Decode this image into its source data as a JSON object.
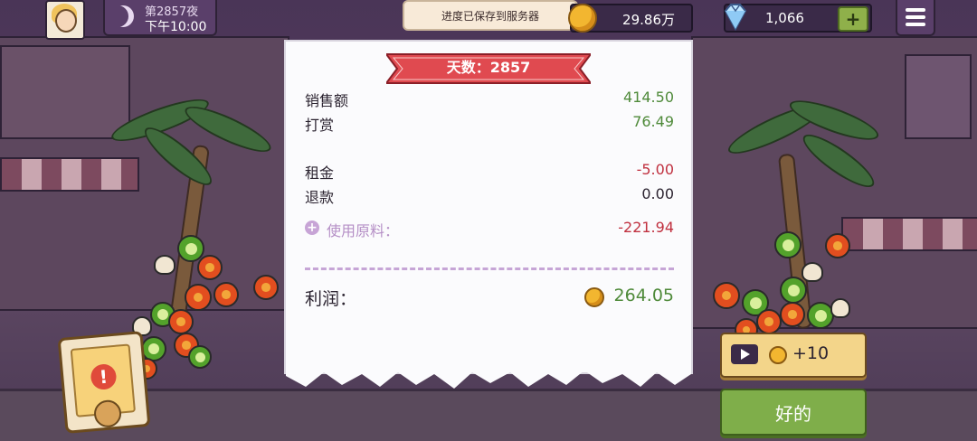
{
  "top_bar": {
    "day_label": "第2857夜",
    "time_label": "下午10:00",
    "toast": "进度已保存到服务器",
    "gold": "29.86万",
    "gems": "1,066",
    "plus_label": "+"
  },
  "receipt": {
    "banner": "天数：2857",
    "rows": [
      {
        "label": "销售额",
        "value": "414.50"
      },
      {
        "label": "打赏",
        "value": "76.49"
      },
      {
        "label": "租金",
        "value": "-5.00"
      },
      {
        "label": "退款",
        "value": "0.00"
      },
      {
        "label": "使用原料：",
        "value": "-221.94"
      }
    ],
    "profit_label": "利润：",
    "profit_value": "264.05"
  },
  "buttons": {
    "ad_reward": "+10",
    "ok": "好的"
  },
  "colors": {
    "positive": "#4f8a3a",
    "negative": "#c0303f",
    "banner": "#e04a50",
    "ok_button": "#7fae4a"
  }
}
